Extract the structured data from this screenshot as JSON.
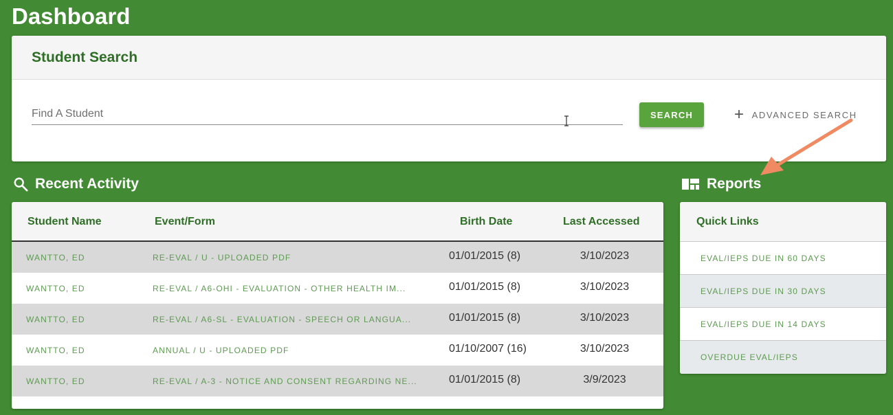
{
  "page": {
    "title": "Dashboard"
  },
  "student_search": {
    "title": "Student Search",
    "placeholder": "Find A Student",
    "value": "",
    "search_label": "SEARCH",
    "advanced_label": "ADVANCED SEARCH"
  },
  "recent_activity": {
    "title": "Recent Activity",
    "columns": [
      "Student Name",
      "Event/Form",
      "Birth Date",
      "Last Accessed"
    ],
    "rows": [
      {
        "name": "WANTTO, ED",
        "event": "RE-EVAL / U - UPLOADED PDF",
        "birth": "01/01/2015 (8)",
        "accessed": "3/10/2023"
      },
      {
        "name": "WANTTO, ED",
        "event": "RE-EVAL / A6-OHI - EVALUATION - OTHER HEALTH IM...",
        "birth": "01/01/2015 (8)",
        "accessed": "3/10/2023"
      },
      {
        "name": "WANTTO, ED",
        "event": "RE-EVAL / A6-SL - EVALUATION - SPEECH OR LANGUA...",
        "birth": "01/01/2015 (8)",
        "accessed": "3/10/2023"
      },
      {
        "name": "WANTTO, ED",
        "event": "ANNUAL / U - UPLOADED PDF",
        "birth": "01/10/2007 (16)",
        "accessed": "3/10/2023"
      },
      {
        "name": "WANTTO, ED",
        "event": "RE-EVAL / A-3 - NOTICE AND CONSENT REGARDING NE...",
        "birth": "01/01/2015 (8)",
        "accessed": "3/9/2023"
      }
    ]
  },
  "reports": {
    "title": "Reports",
    "quick_links_title": "Quick Links",
    "links": [
      "EVAL/IEPS DUE IN 60 DAYS",
      "EVAL/IEPS DUE IN 30 DAYS",
      "EVAL/IEPS DUE IN 14 DAYS",
      "OVERDUE EVAL/IEPS"
    ]
  },
  "icons": {
    "recent": "search-icon",
    "reports": "dashboard-icon",
    "advanced": "plus-icon"
  },
  "colors": {
    "background": "#428a33",
    "accent": "#2f6e26",
    "button": "#5aa43d",
    "link": "#5e9a52",
    "annotation_arrow": "#f08a63"
  }
}
